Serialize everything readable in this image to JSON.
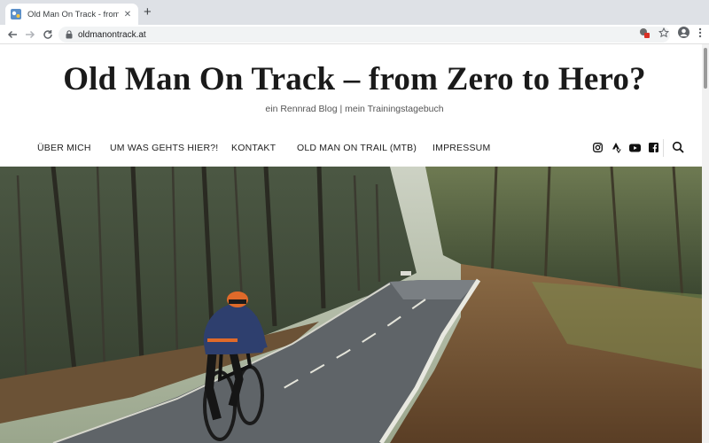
{
  "browser": {
    "tab_title": "Old Man On Track - from Zero",
    "tab_close": "✕",
    "new_tab": "+",
    "url": "oldmanontrack.at"
  },
  "site": {
    "title": "Old Man On Track – from Zero to Hero?",
    "subtitle": "ein Rennrad Blog | mein Trainingstagebuch"
  },
  "nav": {
    "items": [
      "ÜBER MICH",
      "UM WAS GEHTS HIER?!",
      "KONTAKT",
      "OLD MAN ON TRAIL (MTB)",
      "IMPRESSUM"
    ]
  },
  "social": [
    "instagram-icon",
    "strava-icon",
    "youtube-icon",
    "facebook-icon"
  ],
  "colors": {
    "tab_strip": "#dee1e6",
    "accent_rider_jacket": "#2e3f6e",
    "accent_rider_helmet": "#e06a2a"
  }
}
